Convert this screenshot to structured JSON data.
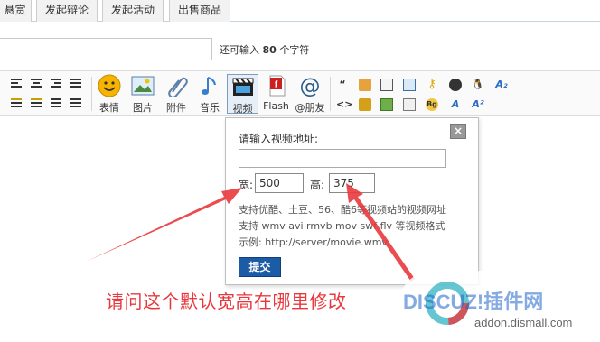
{
  "tabs": [
    {
      "label": "悬赏"
    },
    {
      "label": "发起辩论"
    },
    {
      "label": "发起活动"
    },
    {
      "label": "出售商品"
    }
  ],
  "title_row": {
    "hint_prefix": "还可输入",
    "hint_count": "80",
    "hint_suffix": "个字符"
  },
  "toolbar": {
    "tools": [
      {
        "label": "表情",
        "icon": "smiley-icon"
      },
      {
        "label": "图片",
        "icon": "image-icon"
      },
      {
        "label": "附件",
        "icon": "paperclip-icon"
      },
      {
        "label": "音乐",
        "icon": "music-note-icon"
      },
      {
        "label": "视频",
        "icon": "video-clapper-icon"
      },
      {
        "label": "Flash",
        "icon": "flash-icon"
      },
      {
        "label": "@朋友",
        "icon": "at-icon"
      }
    ],
    "small_icons": [
      "quote-icon",
      "code-icon",
      "lock-icon",
      "table-icon",
      "key-icon",
      "bg-icon",
      "qq-icon",
      "font-icon"
    ],
    "active_tool": "视频"
  },
  "popup": {
    "url_label": "请输入视频地址:",
    "url_value": "",
    "width_label": "宽:",
    "width_value": "500",
    "height_label": "高:",
    "height_value": "375",
    "note_line1": "支持优酷、土豆、56、酷6等视频站的视频网址",
    "note_line2": "支持 wmv avi rmvb mov swf flv 等视频格式",
    "note_line3": "示例: http://server/movie.wmv",
    "submit_label": "提交",
    "close_label": "×"
  },
  "annotation": {
    "question": "请问这个默认宽高在哪里修改",
    "color": "#e8383d"
  },
  "watermark": {
    "brand": "DISCUZ!插件网",
    "site": "addon.dismall.com"
  }
}
